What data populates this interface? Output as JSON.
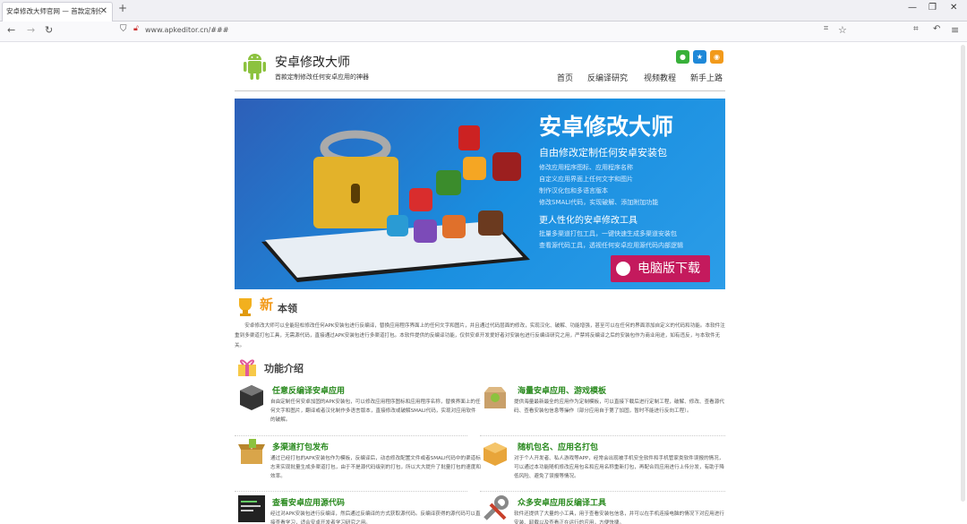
{
  "browser": {
    "tab_title": "安卓修改大师官网 — 首款定制任何",
    "new_tab_label": "+",
    "url": "www.apkeditor.cn/###",
    "win_controls": [
      "—",
      "❐",
      "✕"
    ]
  },
  "site": {
    "title": "安卓修改大师",
    "subtitle": "首款定制修改任何安卓应用的神器",
    "menu": [
      "首页",
      "反编译研究",
      "视频教程",
      "新手上路"
    ]
  },
  "banner": {
    "title": "安卓修改大师",
    "subtitle": "自由修改定制任何安卓安装包",
    "lines": [
      "修改应用程序图标、应用程序名称",
      "自定义应用界面上任何文字和图片",
      "制作汉化包和多语言版本",
      "修改SMALI代码，实现破解、添加附加功能"
    ],
    "subtitle2": "更人性化的安卓修改工具",
    "lines2": [
      "批量多渠道打包工具，一键快速生成多渠道安装包",
      "查看源代码工具，透视任何安卓应用源代码内部逻辑"
    ],
    "download_label": "电脑版下载"
  },
  "skills": {
    "badge": "新",
    "heading": "本领",
    "paragraph": "安卓修改大师可以全能轻松修改任何APK安装包进行反编译，替换应用程序界面上的任何文字和图片，并且通过代码层面的修改，实现汉化、破解、功能增强，甚至可以在任何的界面添加自定义的代码和功能。本软件注重到多渠道打包工具，无需源代码，直接通过APK安装包进行多渠道打包。本软件提供的反编译功能，仅供安卓开发爱好者对安装包进行反编译研究之用，严禁将反编译之后的安装包作为商业用途，如有违反，与本软件无关。"
  },
  "features": {
    "heading": "功能介绍",
    "items": [
      {
        "title": "任意反编译安卓应用",
        "desc": "自由定制任何安卓加固的APK安装包，可以修改应用程序图标和应用程序名称，替换界面上的任何文字和图片，翻译或者汉化制作多语言版本，直接修改或破解SMALI代码，实现对应用软件的破解。"
      },
      {
        "title": "海量安卓应用、游戏模板",
        "desc": "提供海量最新最全的应用作为定制模板，可以直接下载后进行定制工程，破解、修改、查看源代码、查看安装包信息等操作（部分应用自于第了加固，暂时不能进行反向工程）。"
      },
      {
        "title": "多渠道打包发布",
        "desc": "通过已经打包的APK安装包作为模板，反编译后，动态修改配置文件或者SMALI代码中的渠道标志来实现批量生成多渠道打包，由于不是源代码级别的打包，所以大大提升了批量打包的速度和效率。"
      },
      {
        "title": "随机包名、应用名打包",
        "desc": "对于个人开发者、私人游戏等APP，经常会出现被手机安全软件和手机管家类软件误报的情况，可以通过本功能随机修改应用包名和应用名称重新打包，再配合同应用进行上传分发，有助于降低风险、避免了误报等情况。"
      },
      {
        "title": "查看安卓应用源代码",
        "desc": "经过对APK安装包进行反编译，然后通过反编译的方式获取源代码。反编译获得的源代码可以直接查看学习，适合安卓开发者学习研究之用。"
      },
      {
        "title": "众多安卓应用反编译工具",
        "desc": "软件还提供了大量的小工具，用于查看安装包信息，并可以在手机连接电脑的情况下对应用进行安装、卸载以及查看正在运行的应用，方便快捷。"
      }
    ]
  },
  "colors": {
    "banner": "#1f7fd6",
    "accent_green": "#2a8a1f",
    "download": "#c41a5d"
  }
}
